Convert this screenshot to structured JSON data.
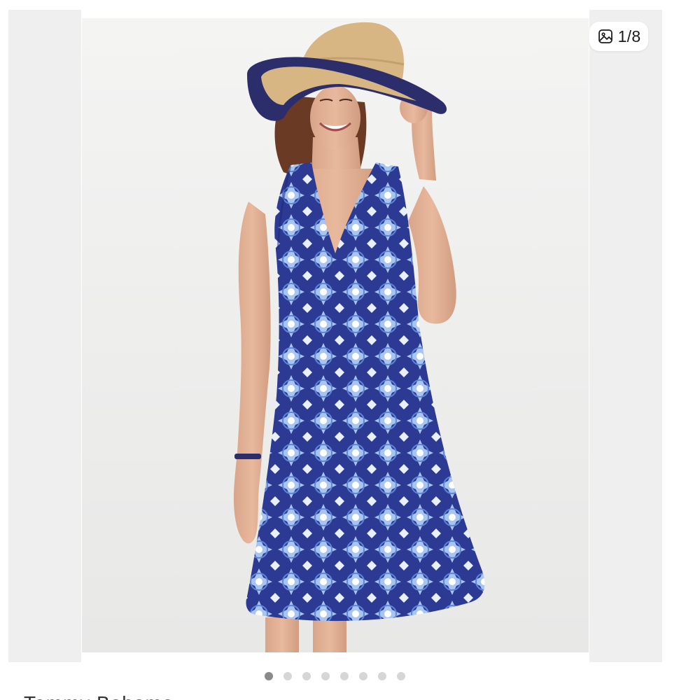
{
  "carousel": {
    "counter_text": "1/8",
    "counter_icon": "image-gallery-icon",
    "total_slides": 8,
    "active_index": 0,
    "slide_image": "photo-woman-blue-print-halter-dress-straw-hat"
  },
  "listing": {
    "brand_name_partial": "Tommy Bahama"
  },
  "colors": {
    "dress_navy": "#2c3a93",
    "print_light": "#a8c4f0",
    "hat_straw": "#d7b684",
    "hat_brim": "#2b2e6b",
    "dot_active": "#8a8a8a",
    "dot_inactive": "#d6d6d6"
  }
}
